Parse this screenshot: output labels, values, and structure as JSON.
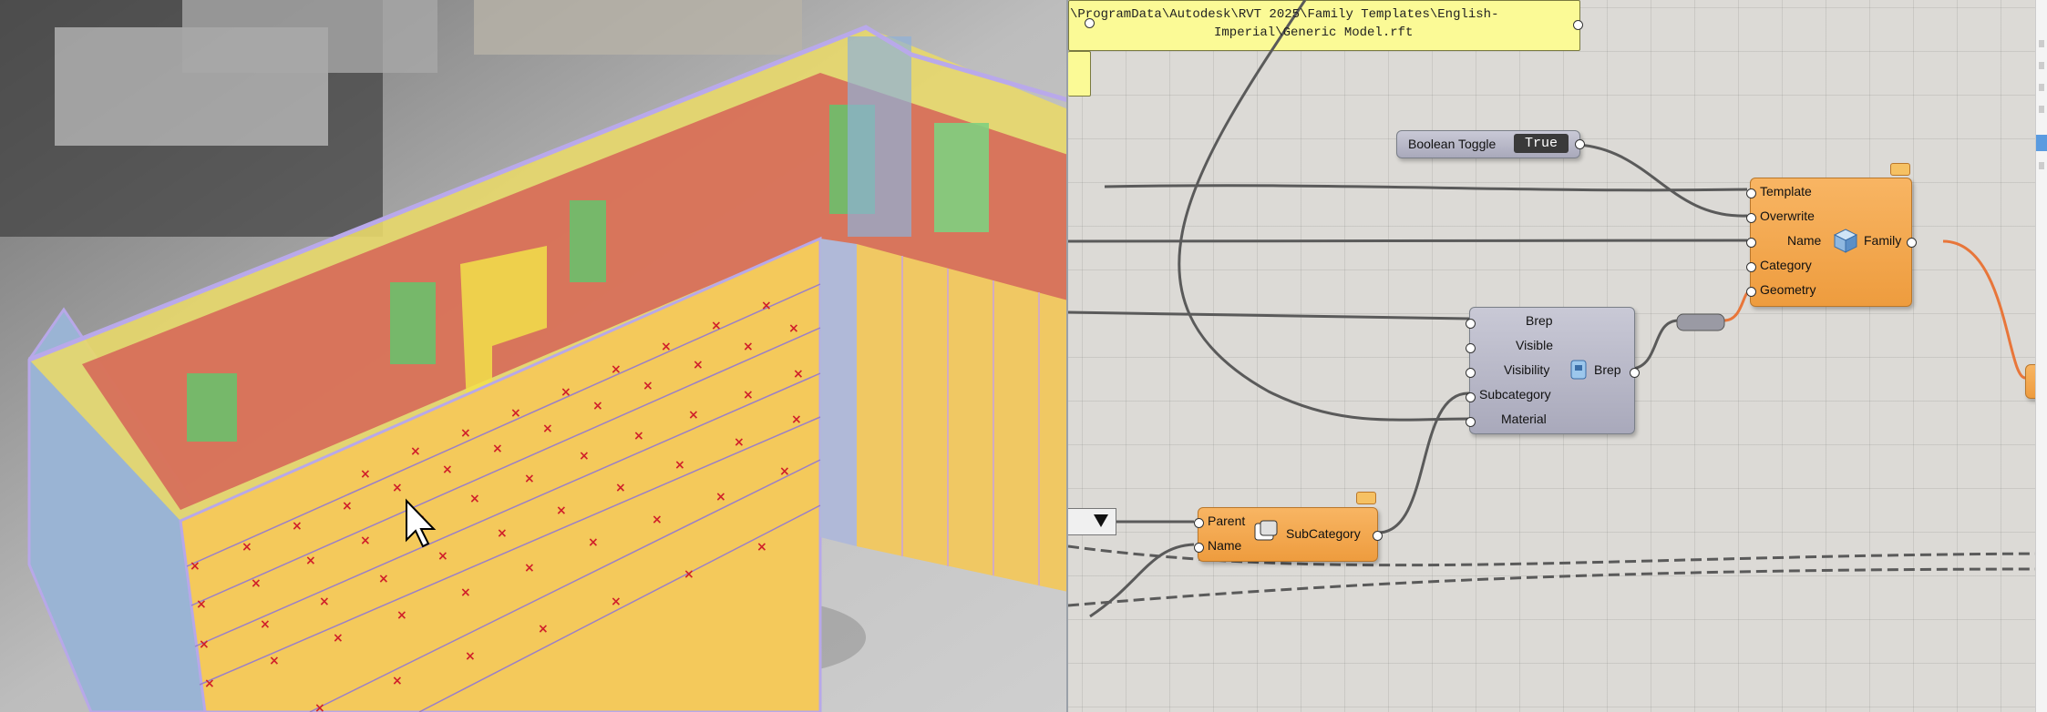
{
  "viewport": {
    "label": "3D building model viewport"
  },
  "canvas": {
    "components": {
      "boolean_toggle": {
        "name": "Boolean Toggle",
        "value": "True"
      },
      "path_panel": {
        "line1": "\\ProgramData\\Autodesk\\RVT 2025\\Family Templates\\English-",
        "line2": "Imperial\\Generic Model.rft"
      },
      "family": {
        "inputs": [
          "Template",
          "Overwrite",
          "Name",
          "Category",
          "Geometry"
        ],
        "output": "Family"
      },
      "brep": {
        "inputs": [
          "Brep",
          "Visible",
          "Visibility",
          "Subcategory",
          "Material"
        ],
        "output": "Brep"
      },
      "subcategory": {
        "inputs": [
          "Parent",
          "Name"
        ],
        "output": "SubCategory"
      }
    },
    "colors": {
      "orange": "#ee9c3e",
      "wire": "#555555",
      "wire_active": "#e8763a",
      "panel": "#fbfa96"
    }
  }
}
